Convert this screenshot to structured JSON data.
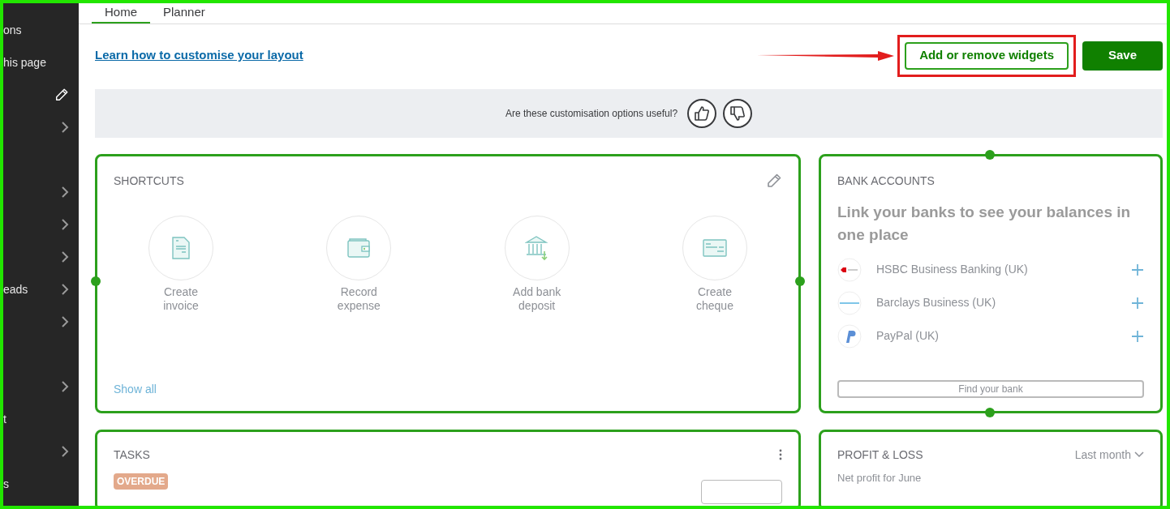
{
  "sidebar": {
    "items": [
      {
        "kind": "link",
        "label": "ons",
        "chevron": false
      },
      {
        "kind": "link",
        "label": "his page",
        "chevron": false
      },
      {
        "kind": "edit"
      },
      {
        "kind": "link",
        "chevron": true
      },
      {
        "kind": "link",
        "chevron": false
      },
      {
        "kind": "link",
        "chevron": true
      },
      {
        "kind": "link",
        "chevron": true
      },
      {
        "kind": "link",
        "chevron": true
      },
      {
        "kind": "link",
        "label": "eads",
        "chevron": true
      },
      {
        "kind": "link",
        "chevron": true
      },
      {
        "kind": "link",
        "chevron": false
      },
      {
        "kind": "link",
        "chevron": true
      },
      {
        "kind": "link",
        "label": "t",
        "chevron": false
      },
      {
        "kind": "link",
        "chevron": true
      },
      {
        "kind": "link",
        "label": "s",
        "chevron": false
      }
    ]
  },
  "tabs": [
    {
      "label": "Home",
      "selected": true
    },
    {
      "label": "Planner",
      "selected": false
    }
  ],
  "toolbar": {
    "help_link": "Learn how to customise your layout",
    "widgets_button": "Add or remove widgets",
    "save_button": "Save",
    "highlighted": true
  },
  "feedback": {
    "question": "Are these customisation options useful?"
  },
  "shortcuts": {
    "title": "SHORTCUTS",
    "items": [
      {
        "kind": "invoice",
        "label": "Create invoice"
      },
      {
        "kind": "expense",
        "label": "Record expense"
      },
      {
        "kind": "deposit",
        "label": "Add bank deposit"
      },
      {
        "kind": "cheque",
        "label": "Create cheque"
      }
    ],
    "show_all": "Show all"
  },
  "bank_accounts": {
    "title": "BANK ACCOUNTS",
    "headline": "Link your banks to see your balances in one place",
    "banks": [
      {
        "kind": "hsbc",
        "name": "HSBC Business Banking (UK)"
      },
      {
        "kind": "barclays",
        "name": "Barclays Business (UK)"
      },
      {
        "kind": "paypal",
        "name": "PayPal (UK)"
      }
    ],
    "find_button": "Find your bank"
  },
  "tasks": {
    "title": "TASKS",
    "badge": "OVERDUE"
  },
  "profit_loss": {
    "title": "PROFIT & LOSS",
    "period": "Last month",
    "subtitle": "Net profit for June"
  }
}
